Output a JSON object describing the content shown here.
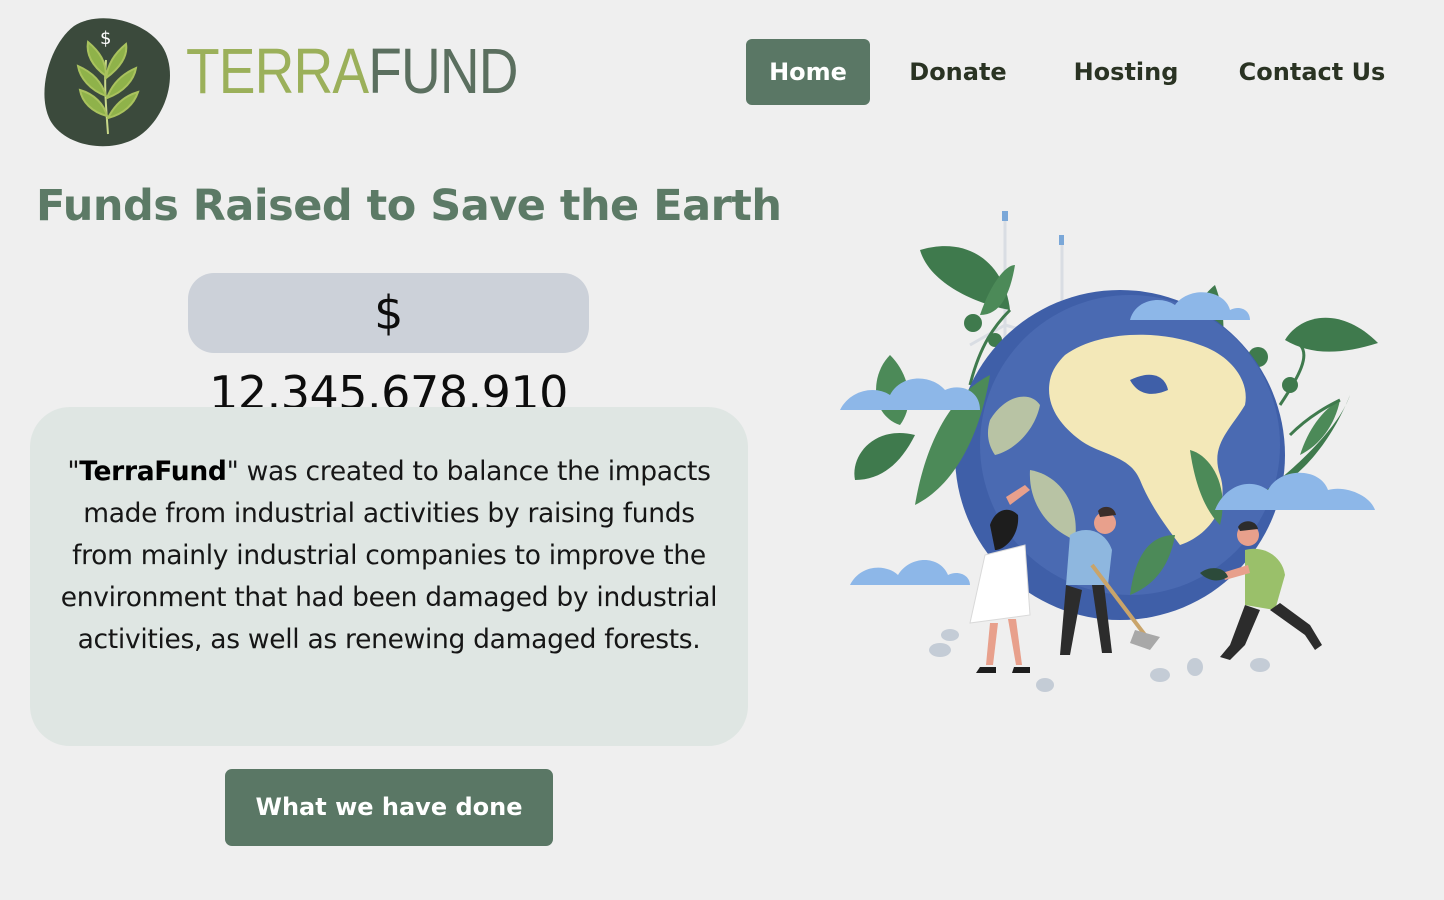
{
  "brand": {
    "logo_terra": "TERRA",
    "logo_fund": "FUND",
    "logo_dollar": "$"
  },
  "nav": {
    "items": [
      {
        "label": "Home",
        "active": true
      },
      {
        "label": "Donate",
        "active": false
      },
      {
        "label": "Hosting",
        "active": false
      },
      {
        "label": "Contact Us",
        "active": false
      }
    ]
  },
  "hero": {
    "headline": "Funds Raised to Save the Earth",
    "amount": "$ 12.345.678.910"
  },
  "about": {
    "brand_name": "TerraFund",
    "text_after": " was created to balance the impacts made from industrial activities by raising funds from mainly industrial companies to improve the environment that had been damaged by industrial activities, as well as renewing damaged forests."
  },
  "cta": {
    "label": "What we have done"
  },
  "colors": {
    "background": "#efefef",
    "accent": "#5a7765",
    "headline": "#5c7a66",
    "logo_terra": "#9bb05a",
    "logo_fund": "#5b6f5f",
    "amount_bg": "#ccd1d9",
    "about_bg": "#dfe6e3"
  },
  "icons": {
    "logo": "leaf-dollar-logo-icon",
    "illustration": "earth-planting-illustration"
  }
}
